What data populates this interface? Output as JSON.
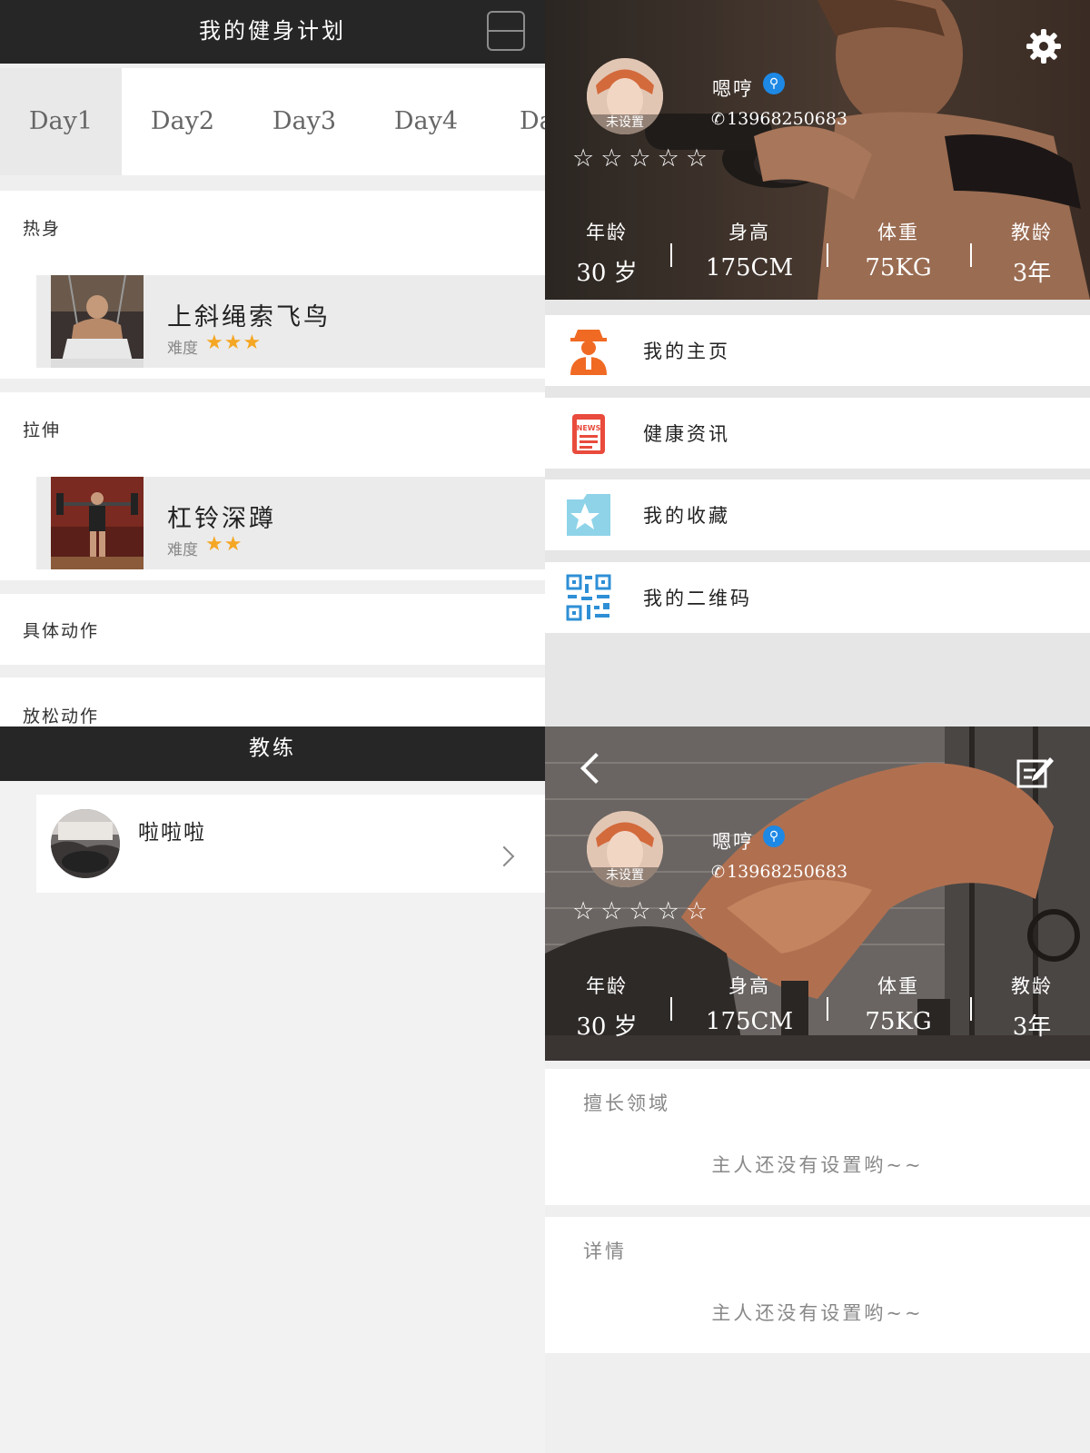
{
  "plan": {
    "title": "我的健身计划",
    "tabs": [
      "Day1",
      "Day2",
      "Day3",
      "Day4",
      "Da"
    ],
    "active_tab": "Day1",
    "sections": [
      {
        "title": "热身",
        "exercises": [
          {
            "name": "上斜绳索飞鸟",
            "difficulty_label": "难度",
            "stars": "★★★",
            "difficulty": 3
          }
        ]
      },
      {
        "title": "拉伸",
        "exercises": [
          {
            "name": "杠铃深蹲",
            "difficulty_label": "难度",
            "stars": "★★",
            "difficulty": 2
          }
        ]
      },
      {
        "title": "具体动作",
        "exercises": []
      },
      {
        "title": "放松动作",
        "exercises": []
      }
    ]
  },
  "profile": {
    "name": "嗯哼",
    "verified_icon": "location-pin-icon",
    "phone": "13968250683",
    "avatar_caption": "未设置",
    "rating_stars": "☆☆☆☆☆",
    "rating": 0,
    "stats": [
      {
        "label": "年龄",
        "value": "30 岁"
      },
      {
        "label": "身高",
        "value": "175CM"
      },
      {
        "label": "体重",
        "value": "75KG"
      },
      {
        "label": "教龄",
        "value": "3年"
      }
    ],
    "menu": [
      {
        "label": "我的主页",
        "icon": "user-avatar-icon"
      },
      {
        "label": "健康资讯",
        "icon": "news-icon"
      },
      {
        "label": "我的收藏",
        "icon": "favorite-folder-icon"
      },
      {
        "label": "我的二维码",
        "icon": "qr-code-icon"
      }
    ],
    "colors": {
      "user_icon": "#f06a24",
      "news_icon": "#e94b3c",
      "fav_icon": "#8ed3e8",
      "qr_icon": "#2e8fd6"
    }
  },
  "coach_list": {
    "title": "教练",
    "items": [
      {
        "name": "啦啦啦"
      }
    ]
  },
  "coach_profile": {
    "name": "嗯哼",
    "phone": "13968250683",
    "avatar_caption": "未设置",
    "rating_stars": "☆☆☆☆☆",
    "stats": [
      {
        "label": "年龄",
        "value": "30 岁"
      },
      {
        "label": "身高",
        "value": "175CM"
      },
      {
        "label": "体重",
        "value": "75KG"
      },
      {
        "label": "教龄",
        "value": "3年"
      }
    ],
    "specialty": {
      "title": "擅长领域",
      "text": "主人还没有设置哟~~"
    },
    "details": {
      "title": "详情",
      "text": "主人还没有设置哟~~"
    }
  }
}
